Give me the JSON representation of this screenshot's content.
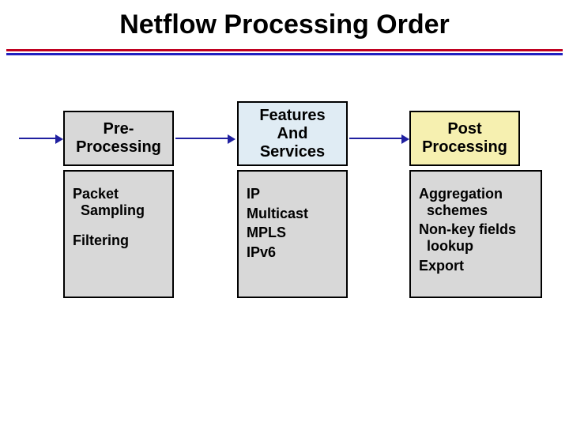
{
  "title": "Netflow Processing Order",
  "stages": {
    "pre": {
      "line1": "Pre-",
      "line2": "Processing"
    },
    "feat": {
      "line1": "Features",
      "line2": "And",
      "line3": "Services"
    },
    "post": {
      "line1": "Post",
      "line2": "Processing"
    }
  },
  "details": {
    "pre": {
      "item1a": "Packet",
      "item1b": "Sampling",
      "item2": "Filtering"
    },
    "feat": {
      "i1": "IP",
      "i2": "Multicast",
      "i3": "MPLS",
      "i4": "IPv6"
    },
    "post": {
      "i1a": "Aggregation",
      "i1b": "schemes",
      "i2a": "Non-key fields",
      "i2b": "lookup",
      "i3": "Export"
    }
  }
}
